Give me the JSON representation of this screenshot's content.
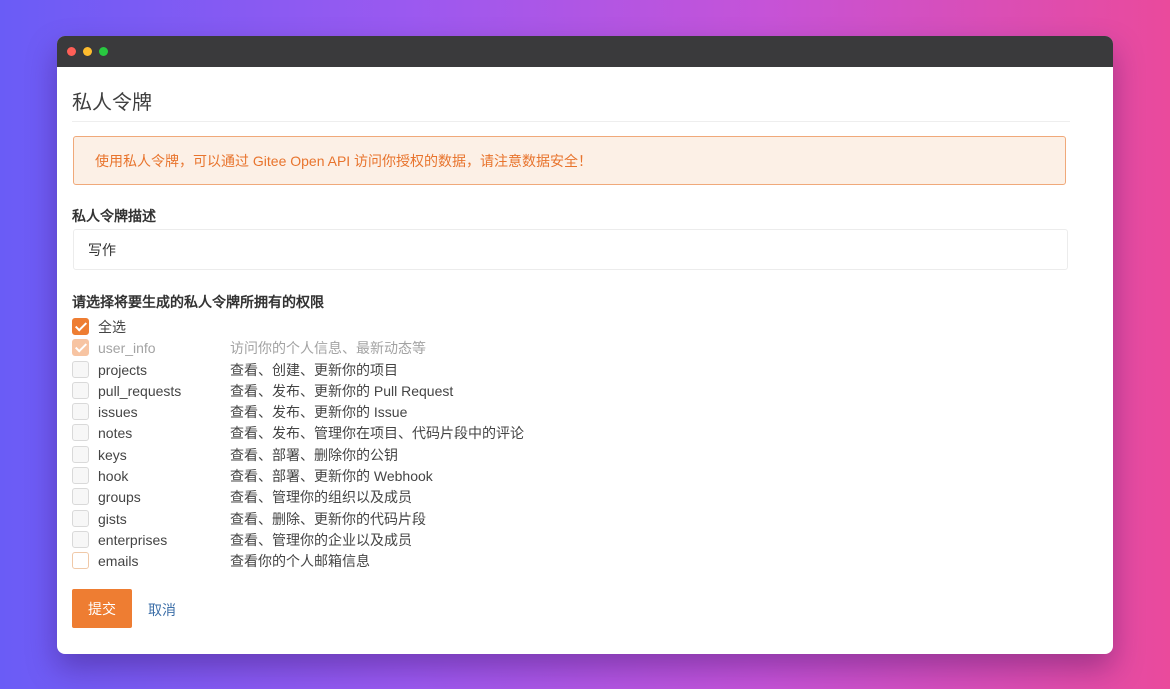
{
  "page": {
    "title": "私人令牌",
    "notice": "使用私人令牌，可以通过 Gitee Open API 访问你授权的数据，请注意数据安全！"
  },
  "form": {
    "desc_label": "私人令牌描述",
    "desc_value": "写作",
    "scope_label": "请选择将要生成的私人令牌所拥有的权限",
    "select_all_label": "全选",
    "scopes": [
      {
        "name": "user_info",
        "desc": "访问你的个人信息、最新动态等",
        "checked": true
      },
      {
        "name": "projects",
        "desc": "查看、创建、更新你的项目",
        "checked": false
      },
      {
        "name": "pull_requests",
        "desc": "查看、发布、更新你的 Pull Request",
        "checked": false
      },
      {
        "name": "issues",
        "desc": "查看、发布、更新你的 Issue",
        "checked": false
      },
      {
        "name": "notes",
        "desc": "查看、发布、管理你在项目、代码片段中的评论",
        "checked": false
      },
      {
        "name": "keys",
        "desc": "查看、部署、删除你的公钥",
        "checked": false
      },
      {
        "name": "hook",
        "desc": "查看、部署、更新你的 Webhook",
        "checked": false
      },
      {
        "name": "groups",
        "desc": "查看、管理你的组织以及成员",
        "checked": false
      },
      {
        "name": "gists",
        "desc": "查看、删除、更新你的代码片段",
        "checked": false
      },
      {
        "name": "enterprises",
        "desc": "查看、管理你的企业以及成员",
        "checked": false
      },
      {
        "name": "emails",
        "desc": "查看你的个人邮箱信息",
        "checked": false
      }
    ],
    "submit_label": "提交",
    "cancel_label": "取消"
  },
  "colors": {
    "accent": "#ee7d32",
    "notice_bg": "#fcf0e6",
    "link": "#3d6fa8"
  }
}
